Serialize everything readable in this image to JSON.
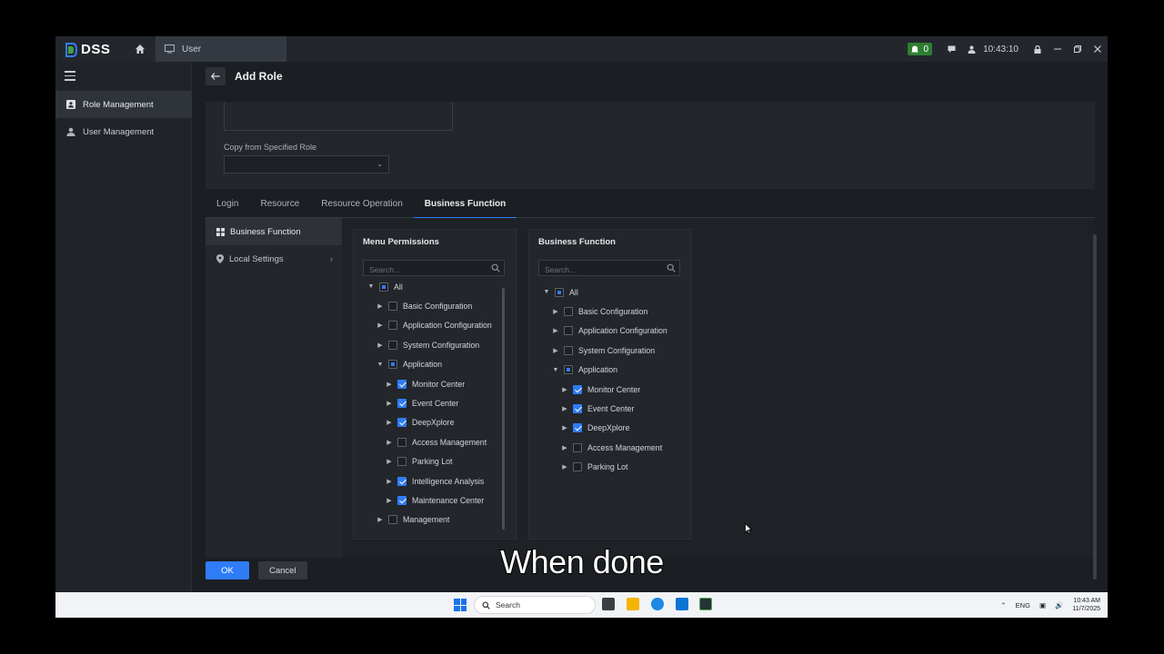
{
  "app": {
    "name": "DSS",
    "tab_label": "User",
    "notification_count": "0",
    "clock": "10:43:10",
    "brand_color": "#2f7cf6"
  },
  "sidebar": {
    "items": [
      {
        "label": "Role Management",
        "active": true
      },
      {
        "label": "User Management",
        "active": false
      }
    ]
  },
  "page": {
    "title": "Add Role",
    "copy_label": "Copy from Specified Role",
    "copy_value": ""
  },
  "tabs": [
    {
      "label": "Login"
    },
    {
      "label": "Resource"
    },
    {
      "label": "Resource Operation"
    },
    {
      "label": "Business Function",
      "active": true
    }
  ],
  "subnav": [
    {
      "label": "Business Function",
      "active": true,
      "icon": "grid-icon"
    },
    {
      "label": "Local Settings",
      "active": false,
      "icon": "location-pin-icon"
    }
  ],
  "menu_permissions": {
    "title": "Menu Permissions",
    "search_placeholder": "Search...",
    "tree": [
      {
        "label": "All",
        "level": 0,
        "caret": "down",
        "state": "partial"
      },
      {
        "label": "Basic Configuration",
        "level": 1,
        "caret": "right",
        "state": "unchecked"
      },
      {
        "label": "Application Configuration",
        "level": 1,
        "caret": "right",
        "state": "unchecked"
      },
      {
        "label": "System Configuration",
        "level": 1,
        "caret": "right",
        "state": "unchecked"
      },
      {
        "label": "Application",
        "level": 1,
        "caret": "down",
        "state": "partial"
      },
      {
        "label": "Monitor Center",
        "level": 2,
        "caret": "right",
        "state": "checked"
      },
      {
        "label": "Event Center",
        "level": 2,
        "caret": "right",
        "state": "checked"
      },
      {
        "label": "DeepXplore",
        "level": 2,
        "caret": "right",
        "state": "checked"
      },
      {
        "label": "Access Management",
        "level": 2,
        "caret": "right",
        "state": "unchecked"
      },
      {
        "label": "Parking Lot",
        "level": 2,
        "caret": "right",
        "state": "unchecked"
      },
      {
        "label": "Intelligence Analysis",
        "level": 2,
        "caret": "right",
        "state": "checked"
      },
      {
        "label": "Maintenance Center",
        "level": 2,
        "caret": "right",
        "state": "checked"
      },
      {
        "label": "Management",
        "level": 1,
        "caret": "right",
        "state": "unchecked"
      }
    ]
  },
  "business_function": {
    "title": "Business Function",
    "search_placeholder": "Search...",
    "tree": [
      {
        "label": "All",
        "level": 0,
        "caret": "down",
        "state": "partial"
      },
      {
        "label": "Basic Configuration",
        "level": 1,
        "caret": "right",
        "state": "unchecked"
      },
      {
        "label": "Application Configuration",
        "level": 1,
        "caret": "right",
        "state": "unchecked"
      },
      {
        "label": "System Configuration",
        "level": 1,
        "caret": "right",
        "state": "unchecked"
      },
      {
        "label": "Application",
        "level": 1,
        "caret": "down",
        "state": "partial"
      },
      {
        "label": "Monitor Center",
        "level": 2,
        "caret": "right",
        "state": "checked"
      },
      {
        "label": "Event Center",
        "level": 2,
        "caret": "right",
        "state": "checked"
      },
      {
        "label": "DeepXplore",
        "level": 2,
        "caret": "right",
        "state": "checked"
      },
      {
        "label": "Access Management",
        "level": 2,
        "caret": "right",
        "state": "unchecked"
      },
      {
        "label": "Parking Lot",
        "level": 2,
        "caret": "right",
        "state": "unchecked"
      }
    ]
  },
  "footer": {
    "ok_label": "OK",
    "cancel_label": "Cancel"
  },
  "taskbar": {
    "search_label": "Search",
    "lang": "ENG",
    "time": "10:43 AM",
    "date": "11/7/2025"
  },
  "caption": "When done"
}
